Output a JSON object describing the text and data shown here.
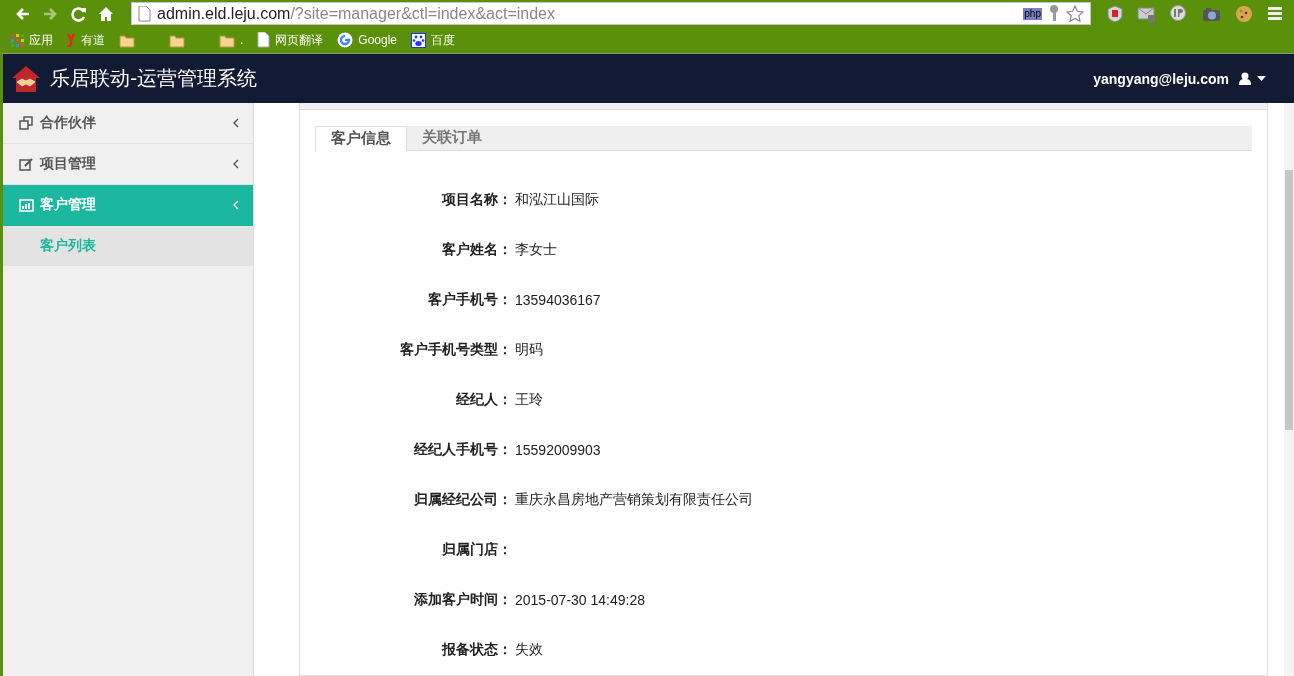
{
  "browser": {
    "url_host": "admin.eld.leju.com",
    "url_path": "/?site=manager&ctl=index&act=index",
    "php_badge": "php",
    "bookmarks": [
      {
        "kind": "apps",
        "label": "应用"
      },
      {
        "kind": "youdao",
        "label": "有道"
      },
      {
        "kind": "folder"
      },
      {
        "kind": "folder"
      },
      {
        "kind": "folder",
        "label": "."
      },
      {
        "kind": "page",
        "label": "网页翻译"
      },
      {
        "kind": "google",
        "label": "Google"
      },
      {
        "kind": "baidu",
        "label": "百度"
      }
    ]
  },
  "header": {
    "title": "乐居联动-运营管理系统",
    "user": "yangyang@leju.com"
  },
  "sidebar": {
    "items": [
      {
        "kind": "partner",
        "label": "合作伙伴",
        "selected": false
      },
      {
        "kind": "edit",
        "label": "项目管理",
        "selected": false
      },
      {
        "kind": "chart",
        "label": "客户管理",
        "selected": true,
        "children": [
          {
            "label": "客户列表",
            "selected": true
          }
        ]
      }
    ]
  },
  "tabs": [
    {
      "label": "客户信息",
      "selected": true
    },
    {
      "label": "关联订单",
      "selected": false
    }
  ],
  "fields": [
    {
      "label": "项目名称：",
      "value": "和泓江山国际"
    },
    {
      "label": "客户姓名：",
      "value": "李女士"
    },
    {
      "label": "客户手机号：",
      "value": "13594036167"
    },
    {
      "label": "客户手机号类型：",
      "value": "明码"
    },
    {
      "label": "经纪人：",
      "value": "王玲"
    },
    {
      "label": "经纪人手机号：",
      "value": "15592009903"
    },
    {
      "label": "归属经纪公司：",
      "value": "重庆永昌房地产营销策划有限责任公司"
    },
    {
      "label": "归属门店："
    },
    {
      "label": "添加客户时间：",
      "value": "2015-07-30 14:49:28"
    },
    {
      "label": "报备状态：",
      "value": "失效"
    }
  ]
}
